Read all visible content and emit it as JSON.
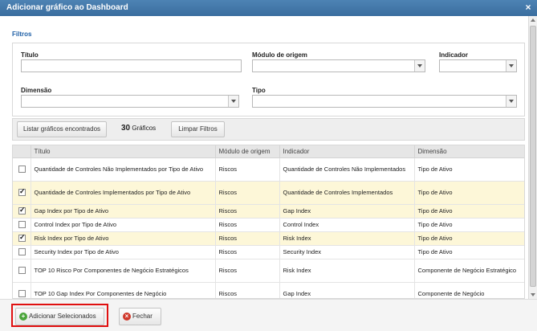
{
  "window": {
    "title": "Adicionar gráfico ao Dashboard",
    "close_glyph": "×"
  },
  "filters": {
    "section_title": "Filtros",
    "titulo_label": "Título",
    "titulo_value": "",
    "modulo_label": "Módulo de origem",
    "modulo_value": "",
    "indicador_label": "Indicador",
    "indicador_value": "",
    "dimensao_label": "Dimensão",
    "dimensao_value": "",
    "tipo_label": "Tipo",
    "tipo_value": ""
  },
  "toolbar": {
    "list_button": "Listar gráficos encontrados",
    "count": "30",
    "count_label": "Gráficos",
    "clear_button": "Limpar Filtros"
  },
  "table": {
    "headers": [
      "Título",
      "Módulo de origem",
      "Indicador",
      "Dimensão"
    ],
    "rows": [
      {
        "checked": false,
        "titulo": "Quantidade de Controles Não Implementados por Tipo de Ativo",
        "modulo": "Riscos",
        "indicador": "Quantidade de Controles Não Implementados",
        "dimensao": "Tipo de Ativo"
      },
      {
        "checked": true,
        "titulo": "Quantidade de Controles Implementados por Tipo de Ativo",
        "modulo": "Riscos",
        "indicador": "Quantidade de Controles Implementados",
        "dimensao": "Tipo de Ativo"
      },
      {
        "checked": true,
        "titulo": "Gap Index por Tipo de Ativo",
        "modulo": "Riscos",
        "indicador": "Gap Index",
        "dimensao": "Tipo de Ativo"
      },
      {
        "checked": false,
        "titulo": "Control Index por Tipo de Ativo",
        "modulo": "Riscos",
        "indicador": "Control Index",
        "dimensao": "Tipo de Ativo"
      },
      {
        "checked": true,
        "titulo": "Risk Index por Tipo de Ativo",
        "modulo": "Riscos",
        "indicador": "Risk Index",
        "dimensao": "Tipo de Ativo"
      },
      {
        "checked": false,
        "titulo": "Security Index por Tipo de Ativo",
        "modulo": "Riscos",
        "indicador": "Security Index",
        "dimensao": "Tipo de Ativo"
      },
      {
        "checked": false,
        "titulo": "TOP 10 Risco Por Componentes de Negócio Estratégicos",
        "modulo": "Riscos",
        "indicador": "Risk Index",
        "dimensao": "Componente de Negócio Estratégico"
      },
      {
        "checked": false,
        "titulo": "TOP 10 Gap Index Por Componentes de Negócio",
        "modulo": "Riscos",
        "indicador": "Gap Index",
        "dimensao": "Componente de Negócio"
      }
    ]
  },
  "footer": {
    "add_button": "Adicionar Selecionados",
    "close_button": "Fechar"
  },
  "colors": {
    "titlebar": "#3a6d9e",
    "section_title": "#1e5fa6",
    "selected_row": "#fdf7d8",
    "highlight": "#e01010"
  }
}
